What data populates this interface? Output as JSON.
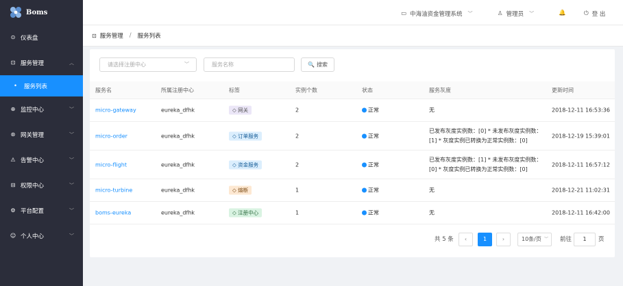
{
  "app": {
    "name": "Boms"
  },
  "sidebar": {
    "items": [
      {
        "icon": "dashboard-icon",
        "glyph": "⊙",
        "label": "仪表盘"
      },
      {
        "icon": "service-icon",
        "glyph": "⊡",
        "label": "服务管理",
        "expanded": true
      },
      {
        "icon": "monitor-icon",
        "glyph": "⊕",
        "label": "监控中心"
      },
      {
        "icon": "gateway-icon",
        "glyph": "⊛",
        "label": "网关管理"
      },
      {
        "icon": "alert-icon",
        "glyph": "⚠",
        "label": "告警中心"
      },
      {
        "icon": "lock-icon",
        "glyph": "🔒",
        "label": "权限中心"
      },
      {
        "icon": "settings-icon",
        "glyph": "⚙",
        "label": "平台配置"
      },
      {
        "icon": "user-icon",
        "glyph": "👤",
        "label": "个人中心"
      }
    ],
    "submenu": {
      "label": "服务列表"
    }
  },
  "header": {
    "system": "中海油资金管理系统",
    "user": "管理员",
    "logout": "登 出"
  },
  "breadcrumb": {
    "parent": "服务管理",
    "current": "服务列表"
  },
  "filters": {
    "registry_placeholder": "请选择注册中心",
    "name_placeholder": "服务名称",
    "search_label": "搜索"
  },
  "table": {
    "columns": [
      "服务名",
      "所属注册中心",
      "标签",
      "实例个数",
      "状态",
      "服务灰度",
      "更新时间"
    ],
    "rows": [
      {
        "name": "micro-gateway",
        "registry": "eureka_dfhk",
        "tag": "网关",
        "tag_color": "purple",
        "count": "2",
        "status": "正常",
        "gray": [
          "无"
        ],
        "updated": "2018-12-11 16:53:36"
      },
      {
        "name": "micro-order",
        "registry": "eureka_dfhk",
        "tag": "订单服务",
        "tag_color": "blue",
        "count": "2",
        "status": "正常",
        "gray": [
          "已发布灰度实例数：[0] * 未发布灰度实例数：",
          "[1] * 灰度实例已转换为正常实例数：[0]"
        ],
        "updated": "2018-12-19 15:39:01"
      },
      {
        "name": "micro-flight",
        "registry": "eureka_dfhk",
        "tag": "资金服务",
        "tag_color": "blue",
        "count": "2",
        "status": "正常",
        "gray": [
          "已发布灰度实例数：[1] * 未发布灰度实例数：",
          "[0] * 灰度实例已转换为正常实例数：[0]"
        ],
        "updated": "2018-12-11 16:57:12"
      },
      {
        "name": "micro-turbine",
        "registry": "eureka_dfhk",
        "tag": "熔断",
        "tag_color": "orange",
        "count": "1",
        "status": "正常",
        "gray": [
          "无"
        ],
        "updated": "2018-12-21 11:02:31"
      },
      {
        "name": "boms-eureka",
        "registry": "eureka_dfhk",
        "tag": "注册中心",
        "tag_color": "green",
        "count": "1",
        "status": "正常",
        "gray": [
          "无"
        ],
        "updated": "2018-12-11 16:42:00"
      }
    ]
  },
  "pagination": {
    "total": "共 5 条",
    "current_page": "1",
    "page_size": "10条/页",
    "goto_label": "前往",
    "goto_value": "1",
    "page_suffix": "页"
  },
  "colors": {
    "sidebar_bg": "#2b2d3a",
    "accent": "#1890ff"
  }
}
